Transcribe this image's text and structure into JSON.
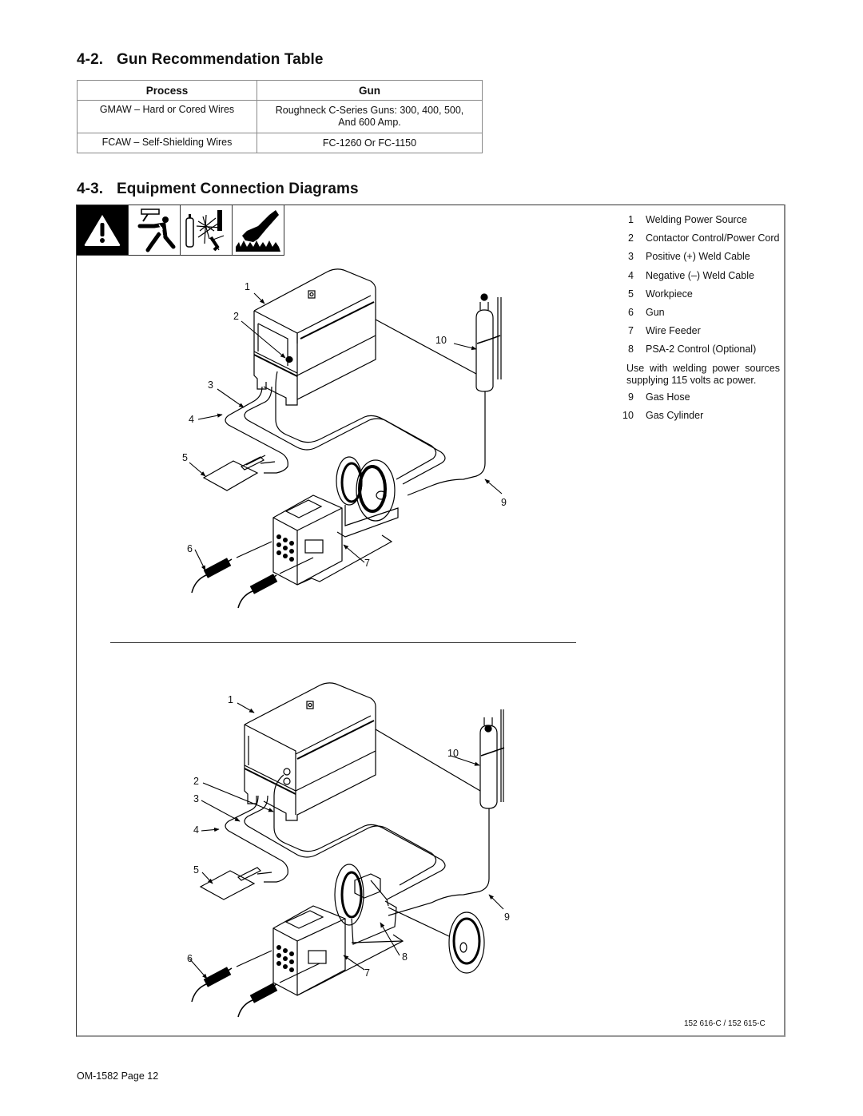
{
  "section_42": {
    "number": "4-2.",
    "title": "Gun Recommendation Table",
    "table": {
      "headers": [
        "Process",
        "Gun"
      ],
      "rows": [
        [
          "GMAW – Hard or Cored Wires",
          "Roughneck C-Series Guns: 300, 400, 500, And 600 Amp."
        ],
        [
          "FCAW – Self-Shielding Wires",
          "FC-1260 Or FC-1150"
        ]
      ]
    }
  },
  "section_43": {
    "number": "4-3.",
    "title": "Equipment Connection Diagrams",
    "warning_icons": [
      "warning-triangle-icon",
      "electric-shock-icon",
      "cylinder-explosion-icon",
      "hot-parts-icon"
    ],
    "legend": [
      {
        "n": "1",
        "label": "Welding Power Source"
      },
      {
        "n": "2",
        "label": "Contactor Control/Power Cord"
      },
      {
        "n": "3",
        "label": "Positive (+) Weld Cable"
      },
      {
        "n": "4",
        "label": "Negative (–) Weld Cable"
      },
      {
        "n": "5",
        "label": "Workpiece"
      },
      {
        "n": "6",
        "label": "Gun"
      },
      {
        "n": "7",
        "label": "Wire Feeder"
      },
      {
        "n": "8",
        "label": "PSA-2 Control (Optional)"
      }
    ],
    "legend_note": "Use with welding power sources supplying 115 volts ac power.",
    "legend_more": [
      {
        "n": "9",
        "label": "Gas Hose"
      },
      {
        "n": "10",
        "label": "Gas Cylinder"
      }
    ],
    "diagram_top_callouts": [
      "1",
      "2",
      "3",
      "4",
      "5",
      "6",
      "7",
      "9",
      "10"
    ],
    "diagram_bottom_callouts": [
      "1",
      "2",
      "3",
      "4",
      "5",
      "6",
      "7",
      "8",
      "9",
      "10"
    ],
    "part_numbers": "152 616-C / 152 615-C"
  },
  "footer": {
    "page": "OM-1582 Page 12"
  }
}
